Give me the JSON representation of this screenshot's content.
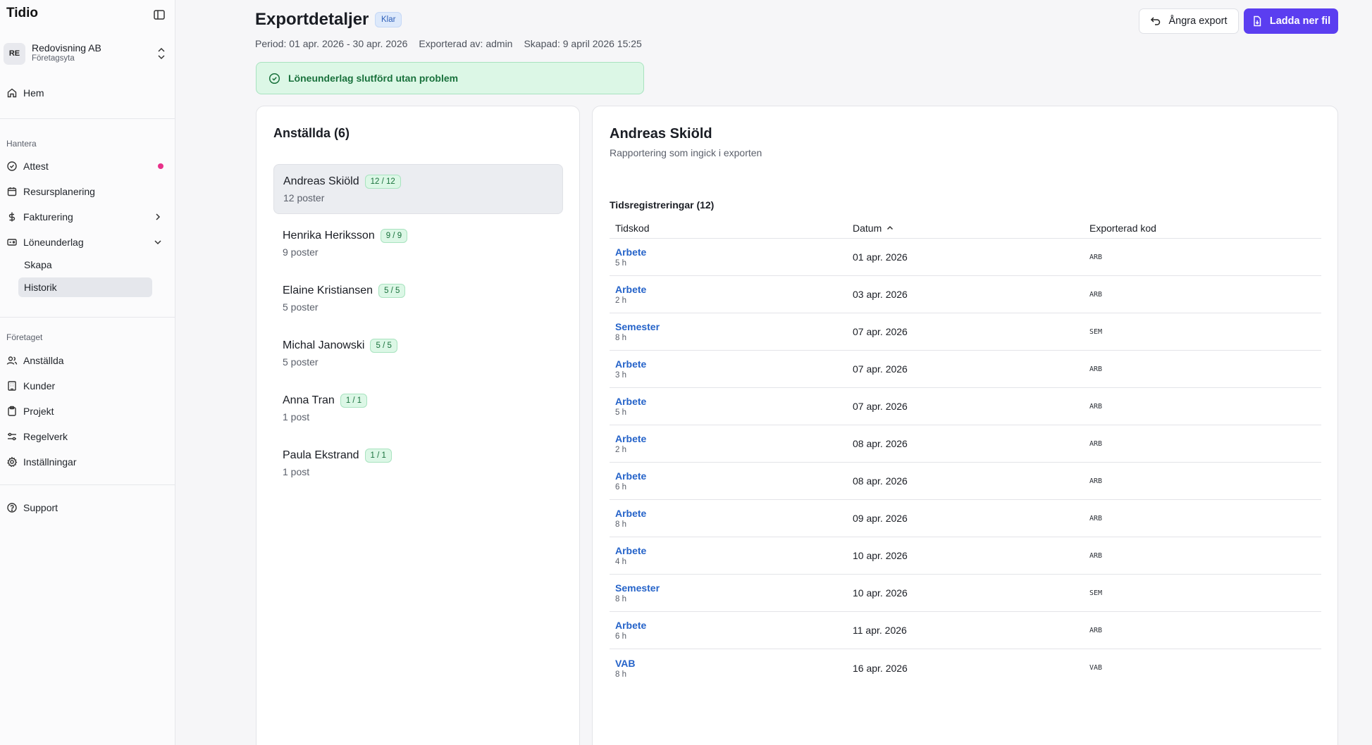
{
  "app": {
    "brand": "Tidio",
    "org_name": "Redovisning AB",
    "org_sub": "Företagsyta",
    "org_initials": "RE"
  },
  "sidebar": {
    "home": "Hem",
    "section_manage": "Hantera",
    "attest": "Attest",
    "resource": "Resursplanering",
    "billing": "Fakturering",
    "payroll": "Löneunderlag",
    "create": "Skapa",
    "history": "Historik",
    "section_company": "Företaget",
    "employees": "Anställda",
    "customers": "Kunder",
    "projects": "Projekt",
    "rules": "Regelverk",
    "settings": "Inställningar",
    "support": "Support"
  },
  "header": {
    "title": "Exportdetaljer",
    "status": "Klar",
    "period": "Period: 01 apr. 2026 - 30 apr. 2026",
    "exported_by": "Exporterad av: admin",
    "created": "Skapad: 9 april 2026 15:25",
    "undo_label": "Ångra export",
    "download_label": "Ladda ner fil"
  },
  "alert": {
    "message": "Löneunderlag slutförd utan problem"
  },
  "employees": {
    "title": "Anställda (6)",
    "items": [
      {
        "name": "Andreas Skiöld",
        "count": "12 / 12",
        "sub": "12 poster"
      },
      {
        "name": "Henrika Heriksson",
        "count": "9 / 9",
        "sub": "9 poster"
      },
      {
        "name": "Elaine Kristiansen",
        "count": "5 / 5",
        "sub": "5 poster"
      },
      {
        "name": "Michal Janowski",
        "count": "5 / 5",
        "sub": "5 poster"
      },
      {
        "name": "Anna Tran",
        "count": "1 / 1",
        "sub": "1 post"
      },
      {
        "name": "Paula Ekstrand",
        "count": "1 / 1",
        "sub": "1 post"
      }
    ]
  },
  "detail": {
    "name": "Andreas Skiöld",
    "subtitle": "Rapportering som ingick i exporten",
    "section": "Tidsregistreringar (12)",
    "columns": {
      "code": "Tidskod",
      "date": "Datum",
      "exported": "Exporterad kod"
    },
    "rows": [
      {
        "code": "Arbete",
        "hours": "5 h",
        "date": "01 apr. 2026",
        "exp": "ARB"
      },
      {
        "code": "Arbete",
        "hours": "2 h",
        "date": "03 apr. 2026",
        "exp": "ARB"
      },
      {
        "code": "Semester",
        "hours": "8 h",
        "date": "07 apr. 2026",
        "exp": "SEM"
      },
      {
        "code": "Arbete",
        "hours": "3 h",
        "date": "07 apr. 2026",
        "exp": "ARB"
      },
      {
        "code": "Arbete",
        "hours": "5 h",
        "date": "07 apr. 2026",
        "exp": "ARB"
      },
      {
        "code": "Arbete",
        "hours": "2 h",
        "date": "08 apr. 2026",
        "exp": "ARB"
      },
      {
        "code": "Arbete",
        "hours": "6 h",
        "date": "08 apr. 2026",
        "exp": "ARB"
      },
      {
        "code": "Arbete",
        "hours": "8 h",
        "date": "09 apr. 2026",
        "exp": "ARB"
      },
      {
        "code": "Arbete",
        "hours": "4 h",
        "date": "10 apr. 2026",
        "exp": "ARB"
      },
      {
        "code": "Semester",
        "hours": "8 h",
        "date": "10 apr. 2026",
        "exp": "SEM"
      },
      {
        "code": "Arbete",
        "hours": "6 h",
        "date": "11 apr. 2026",
        "exp": "ARB"
      },
      {
        "code": "VAB",
        "hours": "8 h",
        "date": "16 apr. 2026",
        "exp": "VAB"
      }
    ]
  }
}
